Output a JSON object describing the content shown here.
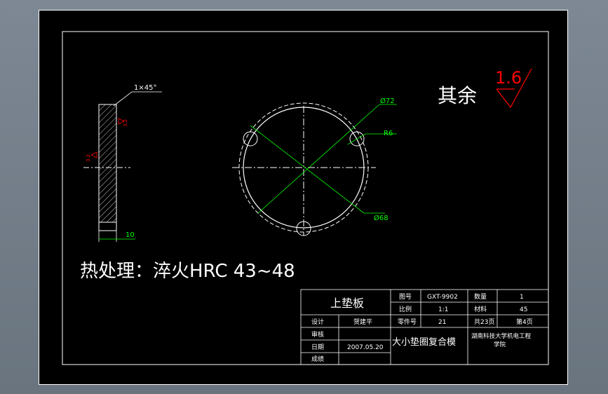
{
  "drawing": {
    "roughness": {
      "label": "其余",
      "value": "1.6"
    },
    "chamfer_label": "1×45°",
    "thickness_dim": "10",
    "small_marks": [
      "3.2",
      "3.2"
    ],
    "dims": {
      "d72": "Ø72",
      "r6": "R6",
      "d68": "Ø68"
    },
    "heat_treatment": "热处理：淬火HRC 43~48"
  },
  "title_block": {
    "part_name": "上垫板",
    "drawing_no_label": "图号",
    "drawing_no": "GXT-9902",
    "qty_label": "数量",
    "qty": "1",
    "scale_label": "比例",
    "scale": "1:1",
    "material_label": "材料",
    "material": "45",
    "designer_label": "设计",
    "designer": "贺建平",
    "part_no_label": "零件号",
    "part_no": "21",
    "total_pages": "共23页",
    "page": "第4页",
    "reviewer_label": "审核",
    "assembly": "大小垫圈复合模",
    "institution": "湖南科技大学机电工程学院",
    "date_label": "日期",
    "date": "2007.05.20",
    "grade_label": "成绩"
  }
}
